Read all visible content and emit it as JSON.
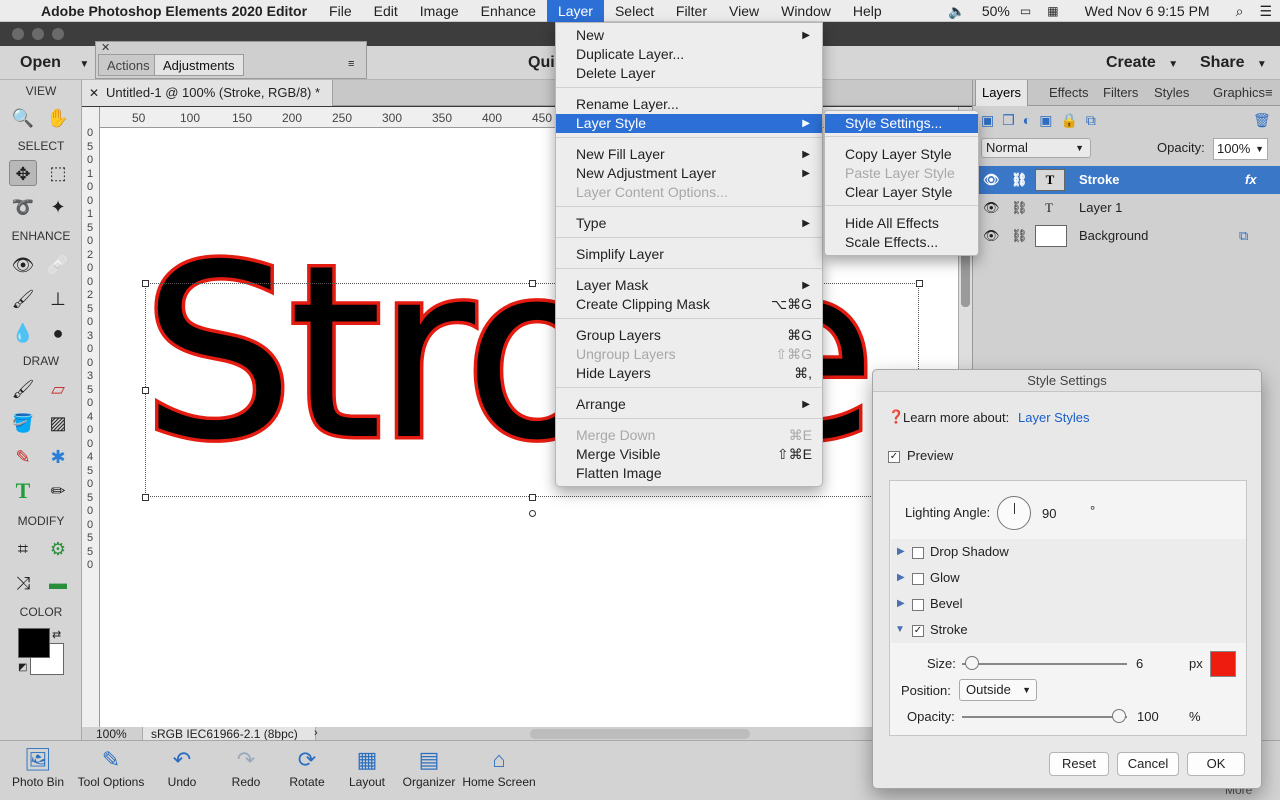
{
  "menubar": {
    "apple": "",
    "app_name": "Adobe Photoshop Elements 2020 Editor",
    "items": [
      "File",
      "Edit",
      "Image",
      "Enhance",
      "Layer",
      "Select",
      "Filter",
      "View",
      "Window",
      "Help"
    ],
    "battery": "50%",
    "clock": "Wed Nov 6  9:15 PM"
  },
  "toprow": {
    "open": "Open",
    "quick": "Qui",
    "create": "Create",
    "share": "Share"
  },
  "float_panel": {
    "tabs": [
      "Actions",
      "Adjustments"
    ]
  },
  "doc_tab": {
    "title": "Untitled-1 @ 100% (Stroke, RGB/8) *"
  },
  "tools": {
    "sections": [
      "VIEW",
      "SELECT",
      "ENHANCE",
      "DRAW",
      "MODIFY",
      "COLOR"
    ]
  },
  "ruler": {
    "h_ticks": [
      "50",
      "100",
      "150",
      "200",
      "250",
      "300",
      "350",
      "400",
      "450"
    ],
    "v_ticks": [
      "0",
      "5",
      "0",
      "1",
      "0",
      "0",
      "1",
      "5",
      "0",
      "2",
      "0",
      "0",
      "2",
      "5",
      "0",
      "3",
      "0",
      "0",
      "3",
      "5",
      "0",
      "4",
      "0",
      "0",
      "4",
      "5",
      "0",
      "5",
      "0",
      "0",
      "5",
      "5",
      "0"
    ]
  },
  "canvas": {
    "text": "Stroke"
  },
  "status": {
    "zoom": "100%",
    "profile": "sRGB IEC61966-2.1 (8bpc)"
  },
  "layer_menu": {
    "items": [
      {
        "label": "New",
        "sub": true,
        "shortcut": "",
        "disabled": false
      },
      {
        "label": "Duplicate Layer...",
        "sub": false,
        "shortcut": "",
        "disabled": false
      },
      {
        "label": "Delete Layer",
        "sub": false,
        "shortcut": "",
        "disabled": false
      },
      {
        "label": "Rename Layer...",
        "sub": false,
        "shortcut": "",
        "disabled": false
      },
      {
        "label": "Layer Style",
        "sub": true,
        "shortcut": "",
        "disabled": false
      },
      {
        "label": "New Fill Layer",
        "sub": true,
        "shortcut": "",
        "disabled": false
      },
      {
        "label": "New Adjustment Layer",
        "sub": true,
        "shortcut": "",
        "disabled": false
      },
      {
        "label": "Layer Content Options...",
        "sub": false,
        "shortcut": "",
        "disabled": true
      },
      {
        "label": "Type",
        "sub": true,
        "shortcut": "",
        "disabled": false
      },
      {
        "label": "Simplify Layer",
        "sub": false,
        "shortcut": "",
        "disabled": false
      },
      {
        "label": "Layer Mask",
        "sub": true,
        "shortcut": "",
        "disabled": false
      },
      {
        "label": "Create Clipping Mask",
        "sub": false,
        "shortcut": "⌥⌘G",
        "disabled": false
      },
      {
        "label": "Group Layers",
        "sub": false,
        "shortcut": "⌘G",
        "disabled": false
      },
      {
        "label": "Ungroup Layers",
        "sub": false,
        "shortcut": "⇧⌘G",
        "disabled": true
      },
      {
        "label": "Hide Layers",
        "sub": false,
        "shortcut": "⌘,",
        "disabled": false
      },
      {
        "label": "Arrange",
        "sub": true,
        "shortcut": "",
        "disabled": false
      },
      {
        "label": "Merge Down",
        "sub": false,
        "shortcut": "⌘E",
        "disabled": true
      },
      {
        "label": "Merge Visible",
        "sub": false,
        "shortcut": "⇧⌘E",
        "disabled": false
      },
      {
        "label": "Flatten Image",
        "sub": false,
        "shortcut": "",
        "disabled": false
      }
    ]
  },
  "style_submenu": {
    "items": [
      {
        "label": "Style Settings...",
        "disabled": false
      },
      {
        "label": "Copy Layer Style",
        "disabled": false
      },
      {
        "label": "Paste Layer Style",
        "disabled": true
      },
      {
        "label": "Clear Layer Style",
        "disabled": false
      },
      {
        "label": "Hide All Effects",
        "disabled": false
      },
      {
        "label": "Scale Effects...",
        "disabled": false
      }
    ]
  },
  "layers_panel": {
    "tabs": [
      "Layers",
      "Effects",
      "Filters",
      "Styles",
      "Graphics"
    ],
    "blend_mode": "Normal",
    "opacity_label": "Opacity:",
    "opacity": "100%",
    "layers": [
      {
        "name": "Stroke",
        "fx": "fx"
      },
      {
        "name": "Layer 1",
        "fx": ""
      },
      {
        "name": "Background",
        "fx": ""
      }
    ]
  },
  "dialog": {
    "title": "Style Settings",
    "learn": "Learn more about:",
    "learn_link": "Layer Styles",
    "preview": "Preview",
    "lighting_label": "Lighting Angle:",
    "lighting_value": "90",
    "degree": "°",
    "effects": [
      {
        "name": "Drop Shadow",
        "checked": false
      },
      {
        "name": "Glow",
        "checked": false
      },
      {
        "name": "Bevel",
        "checked": false
      },
      {
        "name": "Stroke",
        "checked": true
      }
    ],
    "size_label": "Size:",
    "size_value": "6",
    "size_unit": "px",
    "position_label": "Position:",
    "position_value": "Outside",
    "opacity_label": "Opacity:",
    "opacity_value": "100",
    "opacity_unit": "%",
    "stroke_color": "#ee1c0e",
    "reset": "Reset",
    "cancel": "Cancel",
    "ok": "OK"
  },
  "bottombar": {
    "items": [
      "Photo Bin",
      "Tool Options",
      "Undo",
      "Redo",
      "Rotate",
      "Layout",
      "Organizer",
      "Home Screen"
    ],
    "more": "More"
  }
}
